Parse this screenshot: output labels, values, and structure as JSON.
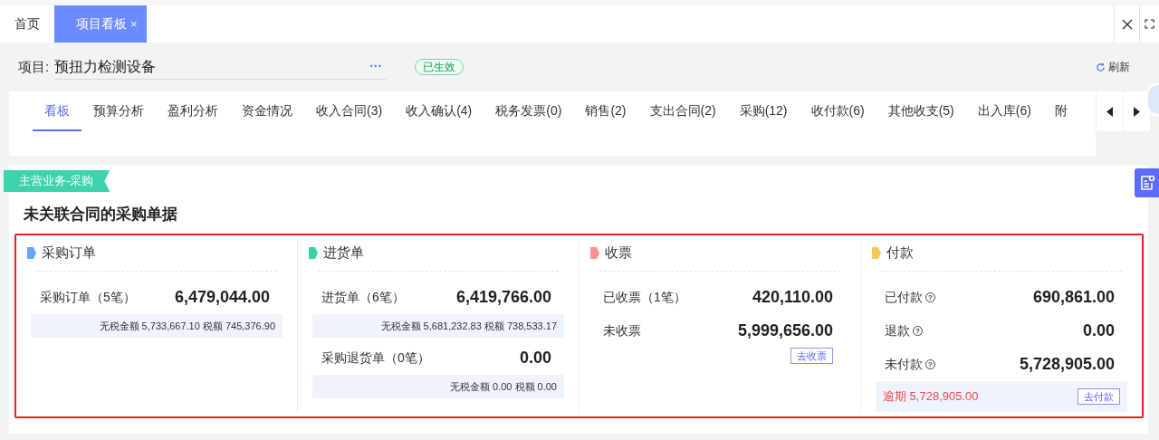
{
  "page_tabs": [
    {
      "label": "首页",
      "selected": false,
      "closable": false
    },
    {
      "label": "项目看板",
      "selected": true,
      "closable": true,
      "close": "×"
    }
  ],
  "project": {
    "label": "项目:",
    "value": "预扭力检测设备",
    "more": "···",
    "status": "已生效",
    "refresh": "刷新"
  },
  "tabs": [
    {
      "label": "看板",
      "selected": true
    },
    {
      "label": "预算分析",
      "selected": false
    },
    {
      "label": "盈利分析",
      "selected": false
    },
    {
      "label": "资金情况",
      "selected": false
    },
    {
      "label": "收入合同(3)",
      "selected": false
    },
    {
      "label": "收入确认(4)",
      "selected": false
    },
    {
      "label": "税务发票(0)",
      "selected": false
    },
    {
      "label": "销售(2)",
      "selected": false
    },
    {
      "label": "支出合同(2)",
      "selected": false
    },
    {
      "label": "采购(12)",
      "selected": false
    },
    {
      "label": "收付款(6)",
      "selected": false
    },
    {
      "label": "其他收支(5)",
      "selected": false
    },
    {
      "label": "出入库(6)",
      "selected": false
    },
    {
      "label": "附",
      "selected": false
    }
  ],
  "ribbon": "主营业务-采购",
  "heading": "未关联合同的采购单据",
  "sections": [
    {
      "title": "采购订单",
      "color": "#6aa5f7",
      "items": [
        {
          "kind": "amount",
          "label": "采购订单（5笔）",
          "value": "6,479,044.00",
          "help": false
        },
        {
          "kind": "detail",
          "text": "无税金额 5,733,667.10 税额 745,376.90"
        }
      ]
    },
    {
      "title": "进货单",
      "color": "#3fcfa8",
      "items": [
        {
          "kind": "amount",
          "label": "进货单（6笔）",
          "value": "6,419,766.00",
          "help": false
        },
        {
          "kind": "detail",
          "text": "无税金额 5,681,232.83 税额 738,533.17"
        },
        {
          "kind": "amount",
          "label": "采购退货单（0笔）",
          "value": "0.00",
          "help": false
        },
        {
          "kind": "detail",
          "text": "无税金额 0.00 税额 0.00"
        }
      ]
    },
    {
      "title": "收票",
      "color": "#fb8f8f",
      "items": [
        {
          "kind": "amount",
          "label": "已收票（1笔）",
          "value": "420,110.00",
          "help": false
        },
        {
          "kind": "amount",
          "label": "未收票",
          "value": "5,999,656.00",
          "help": false
        },
        {
          "kind": "action",
          "button": "去收票"
        }
      ]
    },
    {
      "title": "付款",
      "color": "#f5c85a",
      "items": [
        {
          "kind": "amount",
          "label": "已付款",
          "value": "690,861.00",
          "help": true,
          "help_mark": "?"
        },
        {
          "kind": "amount",
          "label": "退款",
          "value": "0.00",
          "help": true,
          "help_mark": "?"
        },
        {
          "kind": "amount",
          "label": "未付款",
          "value": "5,728,905.00",
          "help": true,
          "help_mark": "?"
        },
        {
          "kind": "overdue",
          "text": "逾期 5,728,905.00",
          "button": "去付款"
        }
      ]
    }
  ]
}
